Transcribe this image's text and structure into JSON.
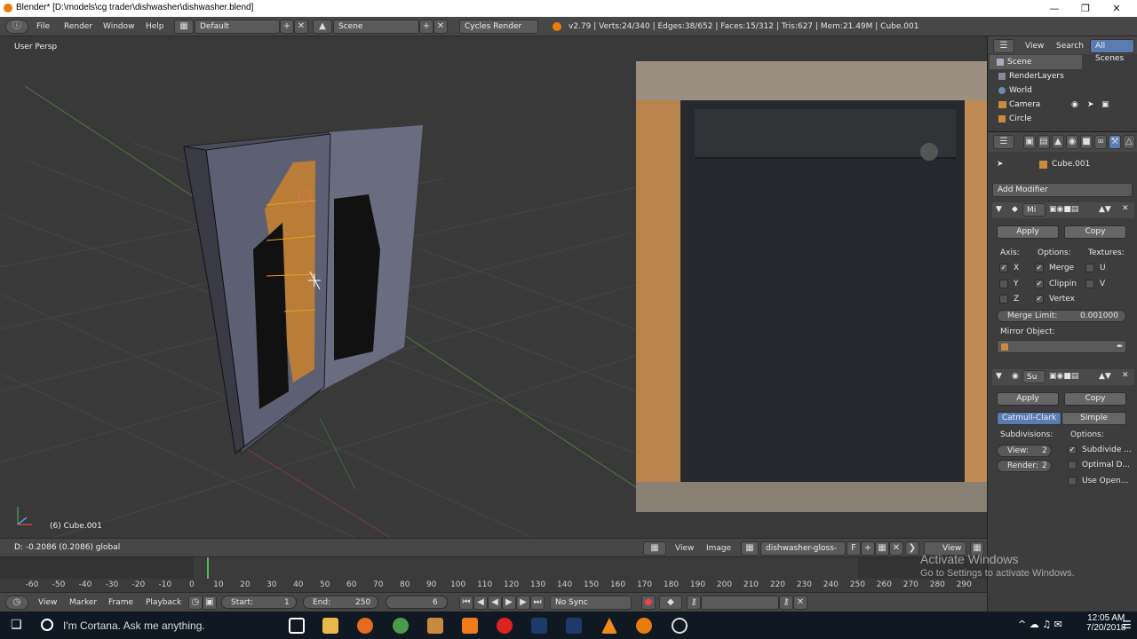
{
  "window": {
    "title": "Blender* [D:\\models\\cg trader\\dishwasher\\dishwasher.blend]"
  },
  "infobar": {
    "menus": [
      "File",
      "Render",
      "Window",
      "Help"
    ],
    "layout": "Default",
    "scene": "Scene",
    "engine": "Cycles Render",
    "stats": "v2.79 | Verts:24/340 | Edges:38/652 | Faces:15/312 | Tris:627 | Mem:21.49M | Cube.001"
  },
  "viewport": {
    "title": "User Persp",
    "object_label": "(6) Cube.001",
    "status": "D: -0.2086 (0.2086) global"
  },
  "image_editor": {
    "menus": [
      "View",
      "Image"
    ],
    "image_name": "dishwasher-gloss-bl...",
    "f_label": "F",
    "view_label": "View"
  },
  "outliner": {
    "menus": [
      "View",
      "Search"
    ],
    "filter": "All Scenes",
    "items": [
      "Scene",
      "RenderLayers",
      "World",
      "Camera",
      "Circle"
    ]
  },
  "properties": {
    "object_name": "Cube.001",
    "add_modifier": "Add Modifier",
    "mirror": {
      "name": "Mi",
      "apply": "Apply",
      "copy": "Copy",
      "axis_label": "Axis:",
      "options_label": "Options:",
      "textures_label": "Textures:",
      "axes": [
        "X",
        "Y",
        "Z"
      ],
      "options": [
        "Merge",
        "Clippin",
        "Vertex"
      ],
      "textures": [
        "U",
        "V"
      ],
      "merge_limit_label": "Merge Limit:",
      "merge_limit_value": "0.001000",
      "mirror_object_label": "Mirror Object:"
    },
    "subsurf": {
      "name": "Su",
      "apply": "Apply",
      "copy": "Copy",
      "catmull": "Catmull-Clark",
      "simple": "Simple",
      "subdivisions_label": "Subdivisions:",
      "options_label": "Options:",
      "view_label": "View:",
      "view_value": "2",
      "render_label": "Render:",
      "render_value": "2",
      "options": [
        "Subdivide ...",
        "Optimal D...",
        "Use Open..."
      ]
    }
  },
  "timeline": {
    "ticks": [
      "-60",
      "-50",
      "-40",
      "-30",
      "-20",
      "-10",
      "0",
      "10",
      "20",
      "30",
      "40",
      "50",
      "60",
      "70",
      "80",
      "90",
      "100",
      "110",
      "120",
      "130",
      "140",
      "150",
      "160",
      "170",
      "180",
      "190",
      "200",
      "210",
      "220",
      "230",
      "240",
      "250",
      "260",
      "270",
      "280",
      "290"
    ],
    "menus": [
      "View",
      "Marker",
      "Frame",
      "Playback"
    ],
    "start_label": "Start:",
    "start_value": "1",
    "end_label": "End:",
    "end_value": "250",
    "current": "6",
    "sync": "No Sync"
  },
  "watermark": {
    "line1": "Activate Windows",
    "line2": "Go to Settings to activate Windows."
  },
  "taskbar": {
    "search": "I'm Cortana. Ask me anything.",
    "time": "12:05 AM",
    "date": "7/20/2018"
  }
}
